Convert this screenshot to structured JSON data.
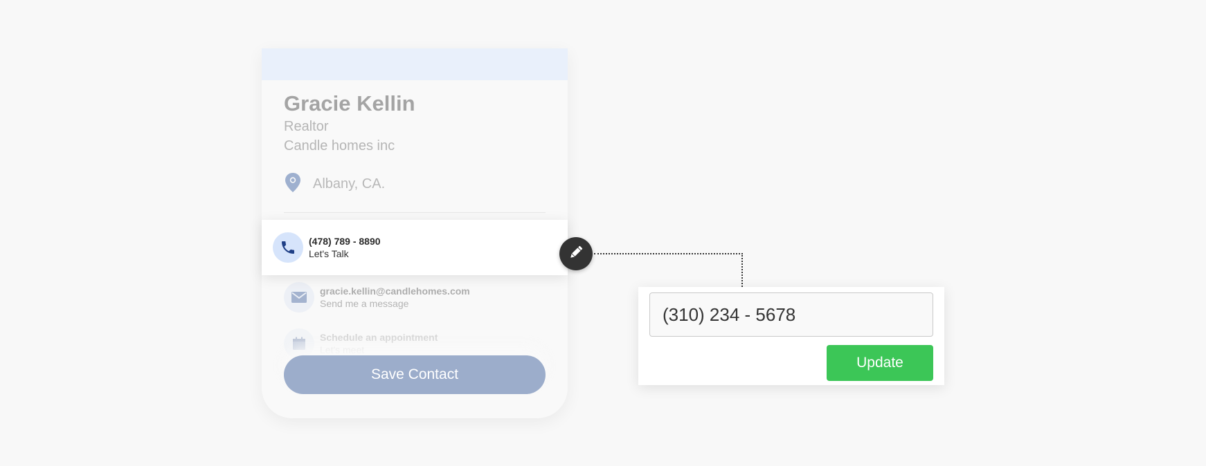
{
  "contact": {
    "name": "Gracie Kellin",
    "role": "Realtor",
    "company": "Candle homes inc",
    "location": "Albany, CA.",
    "phone": {
      "number": "(478) 789 - 8890",
      "caption": "Let's Talk"
    },
    "email": {
      "address": "gracie.kellin@candlehomes.com",
      "caption": "Send me a message"
    },
    "appointment": {
      "label": "Schedule an appointment",
      "caption": "Let's meet"
    },
    "save_label": "Save Contact"
  },
  "editor": {
    "phone_value": "(310) 234 - 5678",
    "update_label": "Update"
  },
  "icons": {
    "location": "map-pin-icon",
    "phone": "phone-icon",
    "email": "envelope-icon",
    "appointment": "calendar-icon",
    "edit": "pencil-icon"
  },
  "colors": {
    "accent_blue": "#9cadcb",
    "header_band": "#e9f0fb",
    "phone_icon": "#1f3f86",
    "update_green": "#3cc657",
    "edit_button": "#333333"
  }
}
